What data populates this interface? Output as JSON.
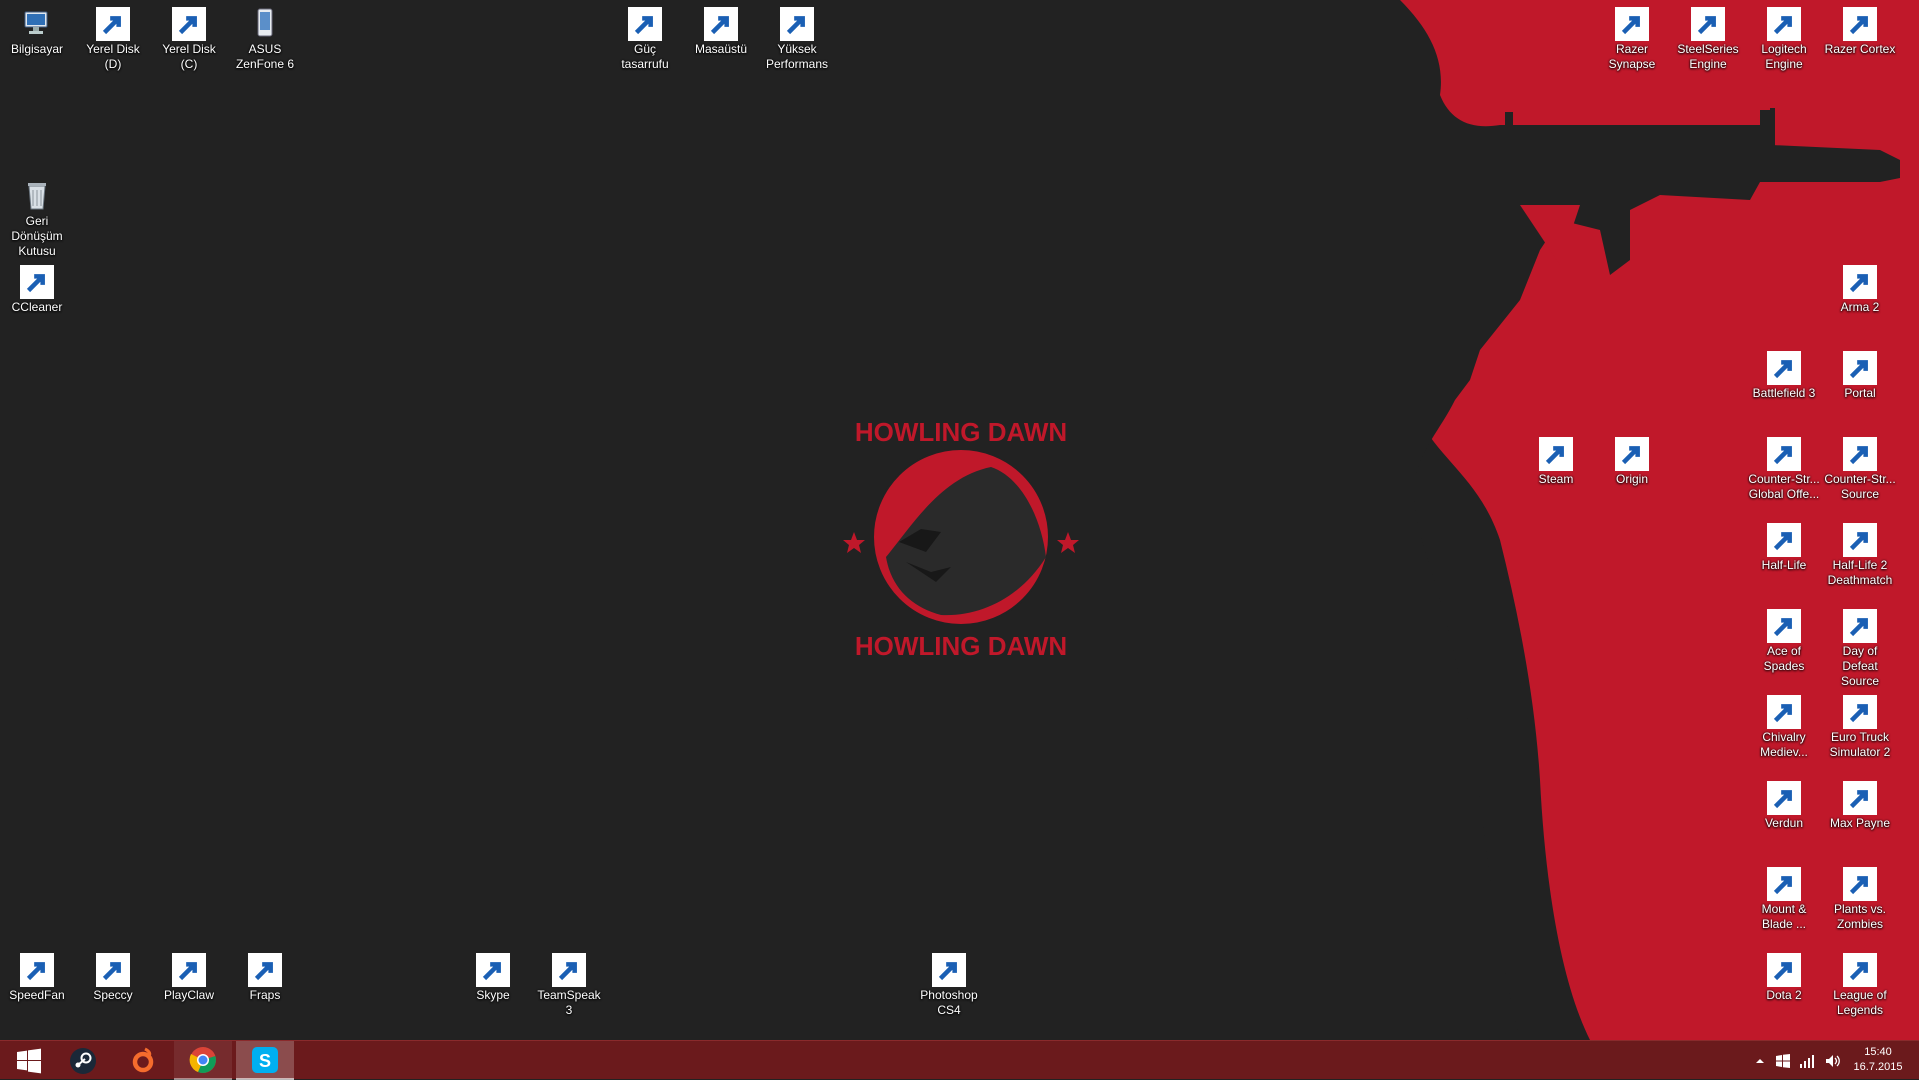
{
  "desktop": {
    "icons_top_left": [
      {
        "label": "Bilgisayar",
        "icon": "computer-icon"
      },
      {
        "label": "Yerel Disk (D)",
        "icon": "drive-icon"
      },
      {
        "label": "Yerel Disk (C)",
        "icon": "windows-drive-icon"
      },
      {
        "label": "ASUS ZenFone 6",
        "icon": "phone-icon"
      }
    ],
    "icons_top_center": [
      {
        "label": "Güç tasarrufu",
        "icon": "battery-icon"
      },
      {
        "label": "Masaüstü",
        "icon": "battery-icon"
      },
      {
        "label": "Yüksek Performans",
        "icon": "battery-icon"
      }
    ],
    "icons_left_column": [
      {
        "label": "Geri Dönüşüm Kutusu",
        "icon": "recycle-bin-icon"
      },
      {
        "label": "CCleaner",
        "icon": "ccleaner-icon"
      }
    ],
    "icons_top_right": [
      {
        "label": "Razer Synapse",
        "icon": "razer-icon"
      },
      {
        "label": "SteelSeries Engine",
        "icon": "steelseries-icon"
      },
      {
        "label": "Logitech Engine",
        "icon": "logitech-icon"
      },
      {
        "label": "Razer Cortex",
        "icon": "razer-icon"
      }
    ],
    "icons_mid_right": [
      {
        "label": "Steam",
        "icon": "steam-icon"
      },
      {
        "label": "Origin",
        "icon": "origin-icon"
      }
    ],
    "icons_right_grid": [
      {
        "label": "Arma 2",
        "icon": "game-icon"
      },
      {
        "label": "Battlefield 3",
        "icon": "game-icon"
      },
      {
        "label": "Portal",
        "icon": "game-icon"
      },
      {
        "label": "Counter-Str... Global Offe...",
        "icon": "game-icon"
      },
      {
        "label": "Counter-Str... Source",
        "icon": "game-icon"
      },
      {
        "label": "Half-Life",
        "icon": "game-icon"
      },
      {
        "label": "Half-Life 2 Deathmatch",
        "icon": "game-icon"
      },
      {
        "label": "Ace of Spades",
        "icon": "game-icon"
      },
      {
        "label": "Day of Defeat Source",
        "icon": "game-icon"
      },
      {
        "label": "Chivalry Mediev...",
        "icon": "game-icon"
      },
      {
        "label": "Euro Truck Simulator 2",
        "icon": "game-icon"
      },
      {
        "label": "Verdun",
        "icon": "game-icon"
      },
      {
        "label": "Max Payne",
        "icon": "game-icon"
      },
      {
        "label": "Mount & Blade ...",
        "icon": "game-icon"
      },
      {
        "label": "Plants vs. Zombies",
        "icon": "game-icon"
      },
      {
        "label": "Dota 2",
        "icon": "game-icon"
      },
      {
        "label": "League of Legends",
        "icon": "game-icon"
      }
    ],
    "icons_bottom": [
      {
        "label": "SpeedFan",
        "icon": "speedfan-icon"
      },
      {
        "label": "Speccy",
        "icon": "speccy-icon"
      },
      {
        "label": "PlayClaw",
        "icon": "playclaw-icon"
      },
      {
        "label": "Fraps",
        "icon": "fraps-icon"
      },
      {
        "label": "Skype",
        "icon": "skype-icon"
      },
      {
        "label": "TeamSpeak 3",
        "icon": "teamspeak-icon"
      },
      {
        "label": "Photoshop CS4",
        "icon": "photoshop-icon"
      }
    ]
  },
  "wallpaper": {
    "logo_text_top": "HOWLING DAWN",
    "logo_text_bottom": "HOWLING DAWN",
    "accent": "#c0182a",
    "background": "#222222"
  },
  "taskbar": {
    "color": "#6b1a1c",
    "pinned": [
      {
        "name": "start",
        "icon": "windows-logo-icon"
      },
      {
        "name": "steam",
        "icon": "steam-icon"
      },
      {
        "name": "origin",
        "icon": "origin-icon"
      },
      {
        "name": "chrome",
        "icon": "chrome-icon",
        "state": "open"
      },
      {
        "name": "skype",
        "icon": "skype-icon",
        "state": "active"
      }
    ],
    "clock": {
      "time": "15:40",
      "date": "16.7.2015"
    }
  }
}
